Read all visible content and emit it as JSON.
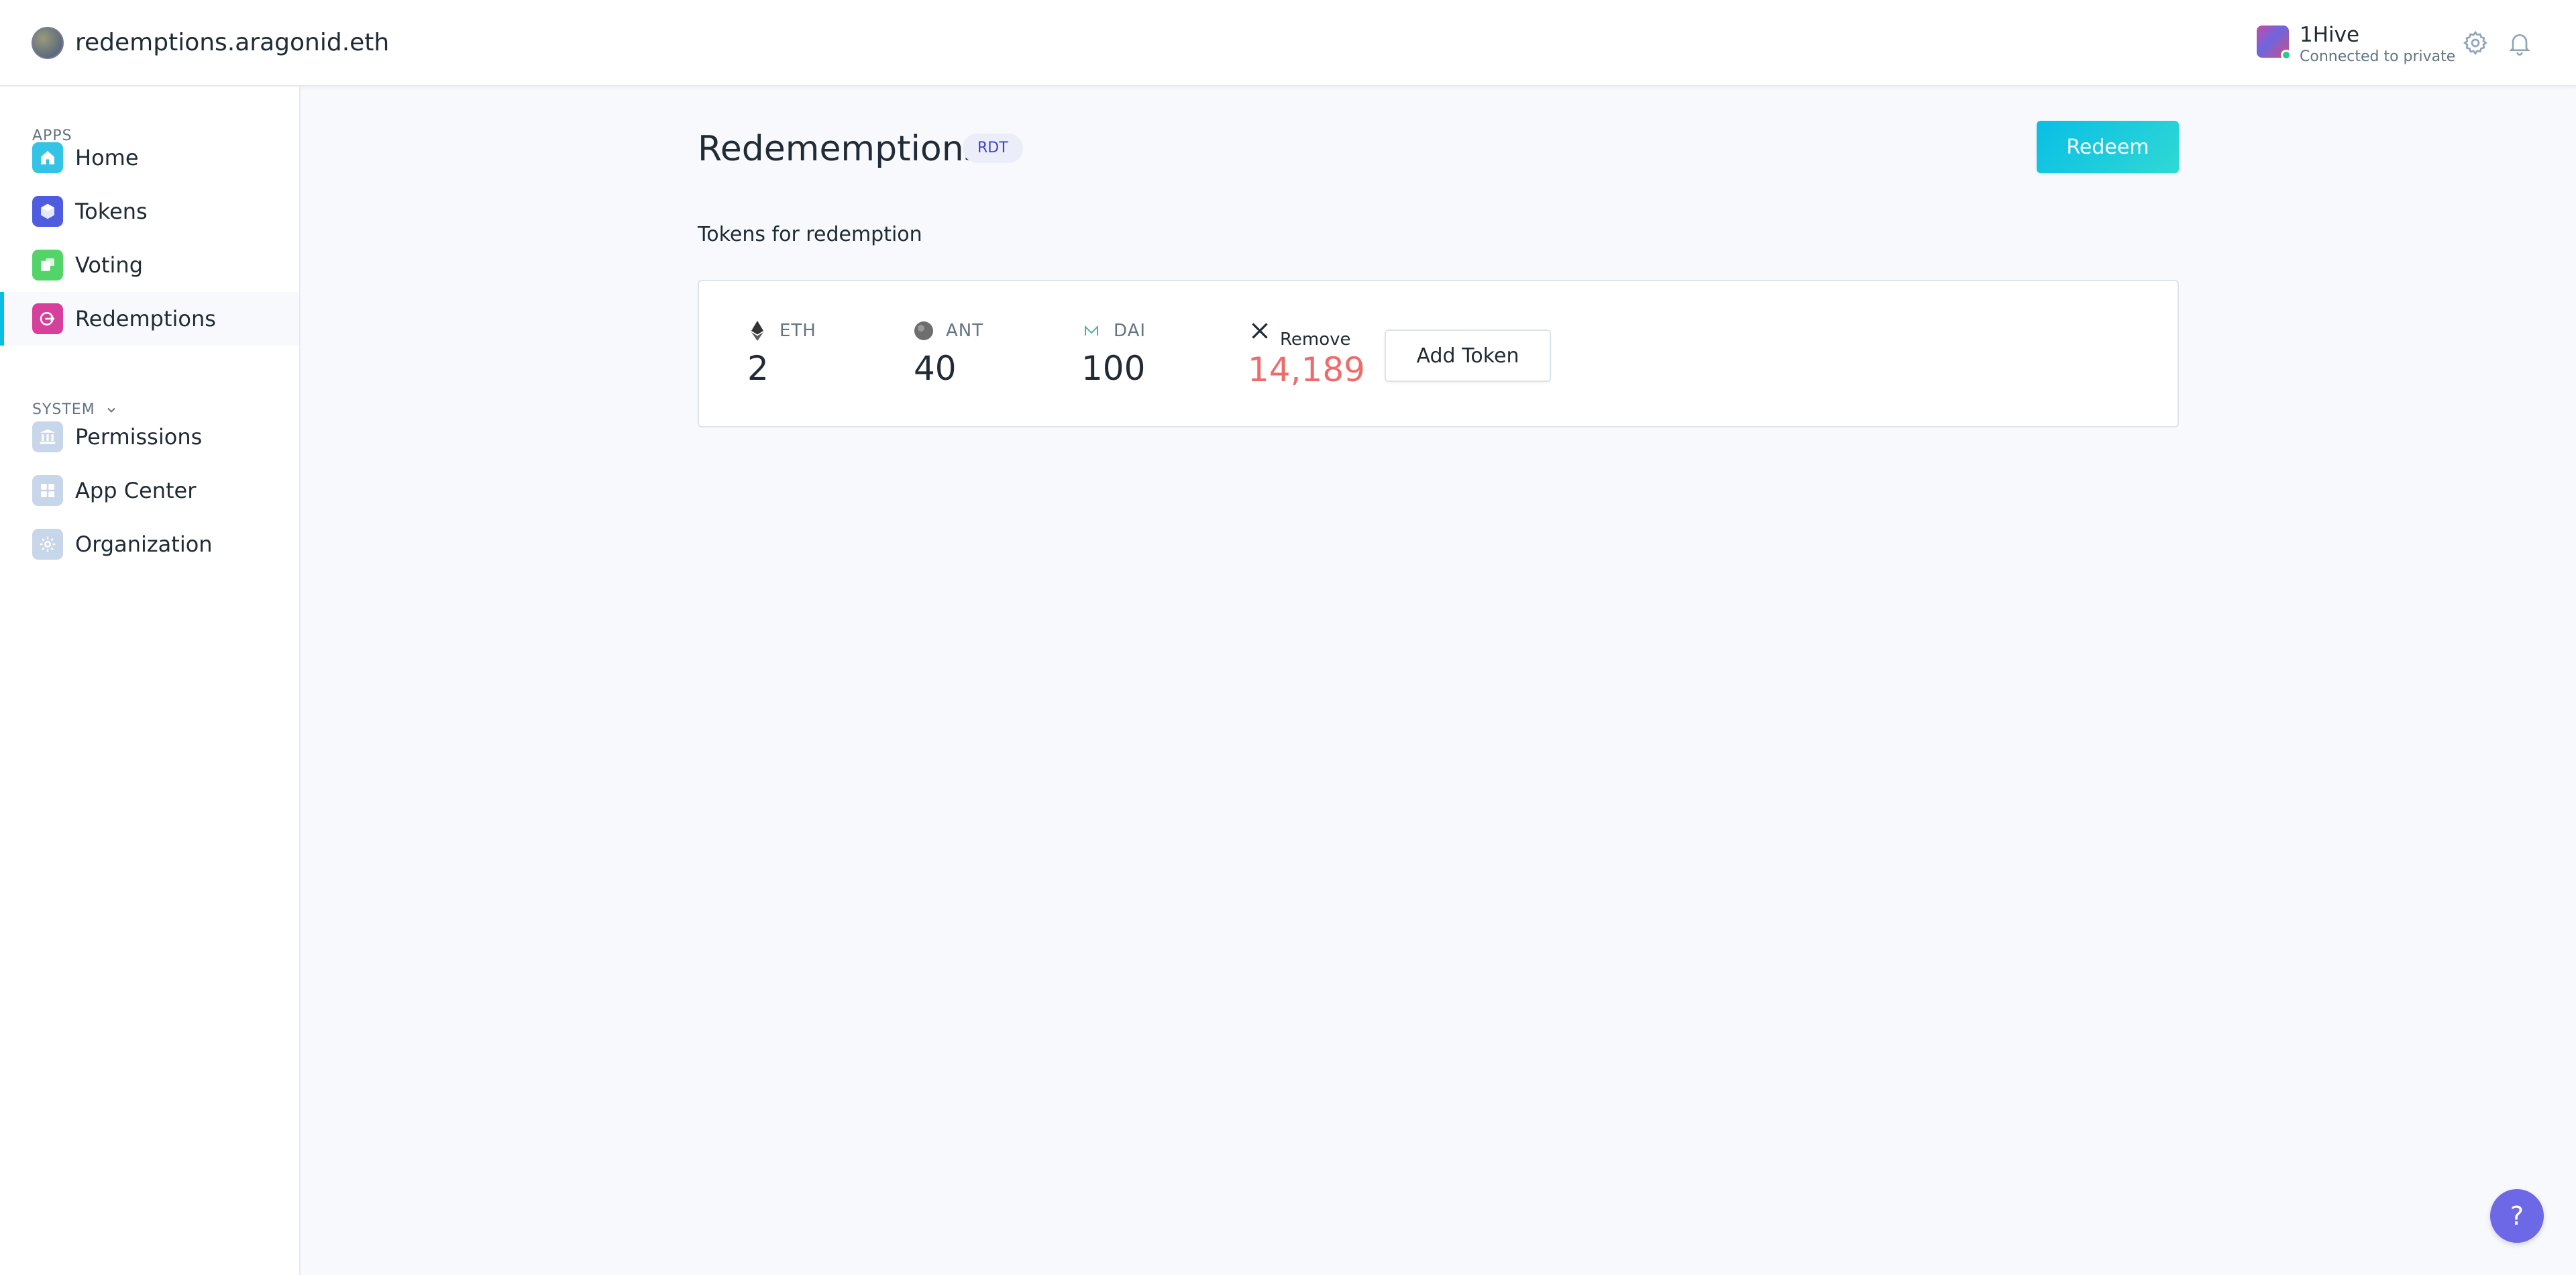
{
  "header": {
    "org_name": "redemptions.aragonid.eth",
    "account_name": "1Hive",
    "account_status": "Connected to private",
    "icons": [
      "org-avatar",
      "settings-icon",
      "notifications-icon"
    ]
  },
  "sidebar": {
    "apps_label": "APPS",
    "system_label": "SYSTEM",
    "apps": [
      {
        "label": "Home",
        "icon": "home-icon",
        "color": "#34c3e5"
      },
      {
        "label": "Tokens",
        "icon": "tokens-icon",
        "color": "#4f5ce0"
      },
      {
        "label": "Voting",
        "icon": "voting-icon",
        "color": "#52d468"
      },
      {
        "label": "Redemptions",
        "icon": "redemptions-icon",
        "color": "#d6409b",
        "active": true
      }
    ],
    "system": [
      {
        "label": "Permissions",
        "icon": "permissions-icon"
      },
      {
        "label": "App Center",
        "icon": "app-center-icon"
      },
      {
        "label": "Organization",
        "icon": "organization-icon"
      }
    ]
  },
  "main": {
    "title": "Redememptions",
    "badge": "RDT",
    "redeem_label": "Redeem",
    "subheading": "Tokens for redemption",
    "tokens": [
      {
        "symbol": "ETH",
        "value": "2",
        "icon": "eth-icon"
      },
      {
        "symbol": "ANT",
        "value": "40",
        "icon": "ant-icon"
      },
      {
        "symbol": "DAI",
        "value": "100",
        "icon": "dai-icon"
      }
    ],
    "remove_label": "Remove",
    "remove_value": "14,189",
    "add_token_label": "Add Token"
  },
  "help": {
    "label": "?"
  },
  "colors": {
    "accent": "#08bee5",
    "badge_text": "#4441cf",
    "danger": "#ee6b6b",
    "help": "#6d68e6"
  }
}
